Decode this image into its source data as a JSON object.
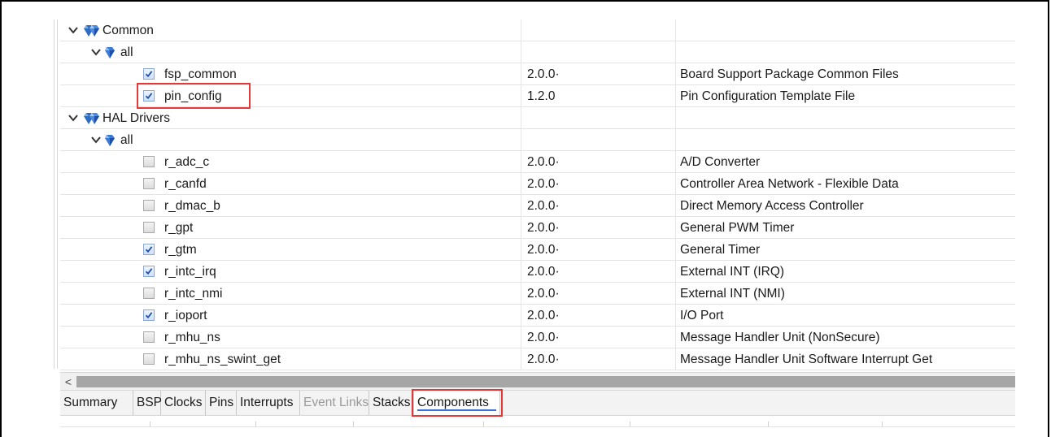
{
  "tree": {
    "rows": [
      {
        "kind": "group",
        "level": 0,
        "label": "Common",
        "version": "",
        "description": ""
      },
      {
        "kind": "subgroup",
        "level": 1,
        "label": "all",
        "version": "",
        "description": ""
      },
      {
        "kind": "component",
        "level": 2,
        "label": "fsp_common",
        "checked": true,
        "version": "2.0.0·",
        "description": "Board Support Package Common Files"
      },
      {
        "kind": "component",
        "level": 2,
        "label": "pin_config",
        "checked": true,
        "version": "1.2.0",
        "description": "Pin Configuration Template File",
        "highlighted": true
      },
      {
        "kind": "group",
        "level": 0,
        "label": "HAL Drivers",
        "version": "",
        "description": ""
      },
      {
        "kind": "subgroup",
        "level": 1,
        "label": "all",
        "version": "",
        "description": ""
      },
      {
        "kind": "component",
        "level": 2,
        "label": "r_adc_c",
        "checked": false,
        "version": "2.0.0·",
        "description": "A/D Converter"
      },
      {
        "kind": "component",
        "level": 2,
        "label": "r_canfd",
        "checked": false,
        "version": "2.0.0·",
        "description": "Controller Area Network - Flexible Data"
      },
      {
        "kind": "component",
        "level": 2,
        "label": "r_dmac_b",
        "checked": false,
        "version": "2.0.0·",
        "description": "Direct Memory Access Controller"
      },
      {
        "kind": "component",
        "level": 2,
        "label": "r_gpt",
        "checked": false,
        "version": "2.0.0·",
        "description": "General PWM Timer"
      },
      {
        "kind": "component",
        "level": 2,
        "label": "r_gtm",
        "checked": true,
        "version": "2.0.0·",
        "description": "General Timer"
      },
      {
        "kind": "component",
        "level": 2,
        "label": "r_intc_irq",
        "checked": true,
        "version": "2.0.0·",
        "description": "External INT (IRQ)"
      },
      {
        "kind": "component",
        "level": 2,
        "label": "r_intc_nmi",
        "checked": false,
        "version": "2.0.0·",
        "description": "External INT (NMI)"
      },
      {
        "kind": "component",
        "level": 2,
        "label": "r_ioport",
        "checked": true,
        "version": "2.0.0·",
        "description": "I/O Port"
      },
      {
        "kind": "component",
        "level": 2,
        "label": "r_mhu_ns",
        "checked": false,
        "version": "2.0.0·",
        "description": "Message Handler Unit (NonSecure)"
      },
      {
        "kind": "component",
        "level": 2,
        "label": "r_mhu_ns_swint_get",
        "checked": false,
        "version": "2.0.0·",
        "description": "Message Handler Unit Software Interrupt Get"
      }
    ]
  },
  "scrollbar": {
    "left_arrow_icon": "chevron-left-icon",
    "left_arrow_glyph": "<"
  },
  "tabs": [
    {
      "label": "Summary",
      "state": "normal"
    },
    {
      "label": "BSP",
      "state": "normal"
    },
    {
      "label": "Clocks",
      "state": "normal"
    },
    {
      "label": "Pins",
      "state": "normal"
    },
    {
      "label": "Interrupts",
      "state": "normal"
    },
    {
      "label": "Event Links",
      "state": "disabled"
    },
    {
      "label": "Stacks",
      "state": "normal"
    },
    {
      "label": "Components",
      "state": "active",
      "highlighted": true
    }
  ],
  "colors": {
    "highlight": "#e53939",
    "check": "#1f4fa8",
    "tab_underline": "#3a6fd8"
  }
}
